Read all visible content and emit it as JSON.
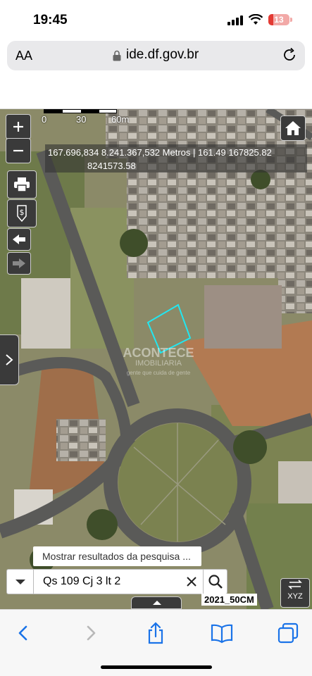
{
  "status_bar": {
    "time": "19:45",
    "battery": "13"
  },
  "browser": {
    "text_size_label": "AA",
    "url": "ide.df.gov.br"
  },
  "map": {
    "scale": {
      "labels": [
        "0",
        "30",
        "60m"
      ]
    },
    "coordinates": {
      "line1": "167.696,834 8.241.367,532 Metros | 161.49 167825.82",
      "line2": "8241573.58"
    },
    "watermark": {
      "name": "ACONTECE",
      "sub": "IMOBILIARIA",
      "tag": "gente que cuida de gente"
    },
    "search": {
      "hint": "Mostrar resultados da pesquisa ...",
      "value": "Qs 109 Cj 3 lt 2"
    },
    "year_label": "2021_50CM",
    "xyz_label": "XYZ"
  },
  "colors": {
    "map_button_bg": "#3a3a3a",
    "ios_blue": "#1a73e8",
    "parcel_outline": "#22e6f0"
  }
}
